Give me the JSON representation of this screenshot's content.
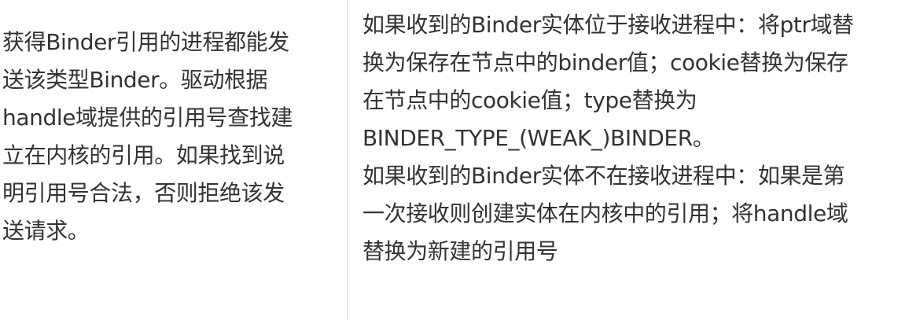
{
  "left_cell": {
    "lines": [
      "获得Binder引用的进程都能发",
      "送该类型Binder。驱动根据",
      "handle域提供的引用号查找建",
      "立在内核的引用。如果找到说",
      "明引用号合法，否则拒绝该发",
      "送请求。"
    ]
  },
  "right_cell": {
    "paragraph_1": [
      "如果收到的Binder实体位于接收进程中：将ptr域替",
      "换为保存在节点中的binder值；cookie替换为保存",
      "在节点中的cookie值；type替换为",
      "BINDER_TYPE_(WEAK_)BINDER。"
    ],
    "paragraph_2": [
      "如果收到的Binder实体不在接收进程中：如果是第",
      "一次接收则创建实体在内核中的引用；将handle域",
      "替换为新建的引用号"
    ]
  }
}
